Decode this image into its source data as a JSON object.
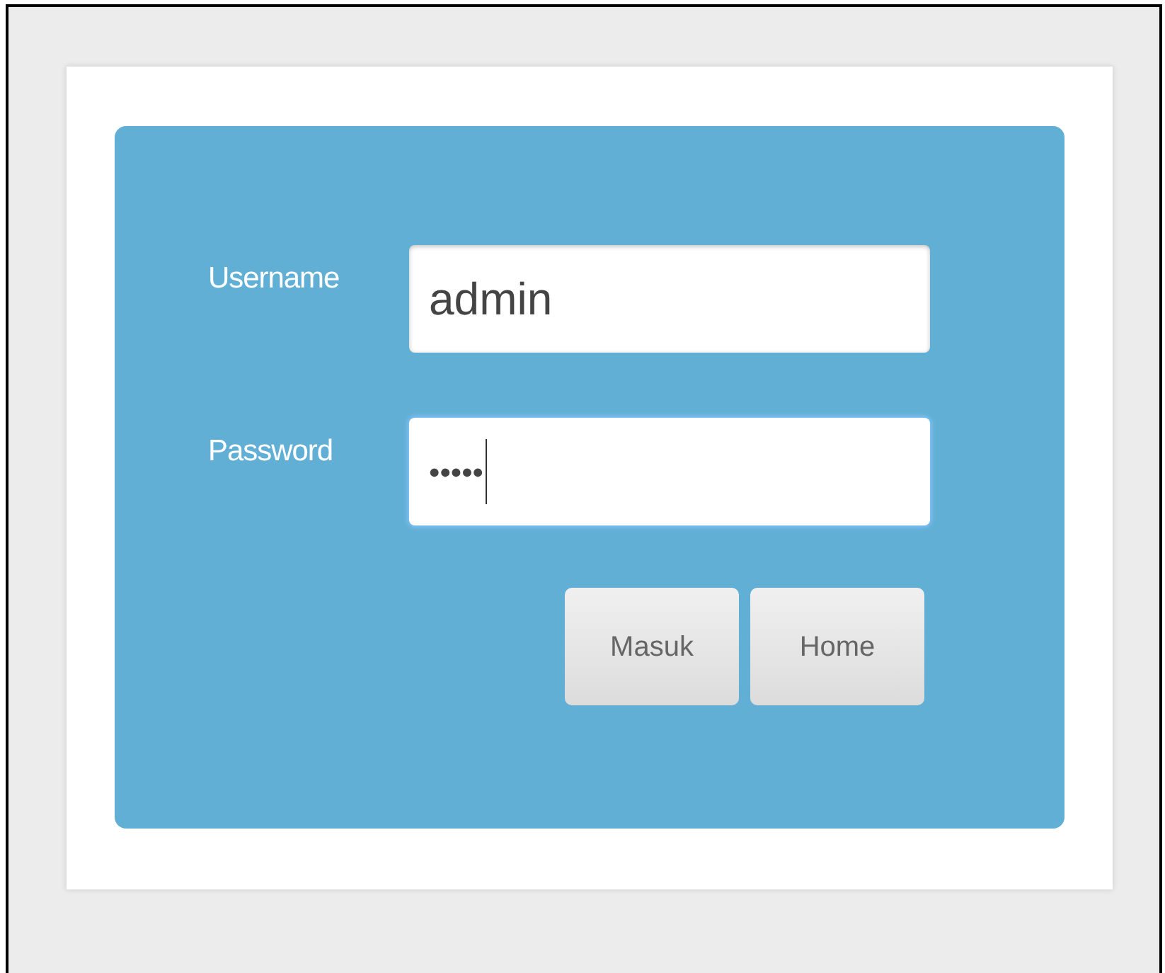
{
  "form": {
    "fields": [
      {
        "label": "Username",
        "value": "admin",
        "focused": false
      },
      {
        "label": "Password",
        "value": "•••••",
        "focused": true
      }
    ],
    "buttons": [
      "Masuk",
      "Home"
    ]
  }
}
